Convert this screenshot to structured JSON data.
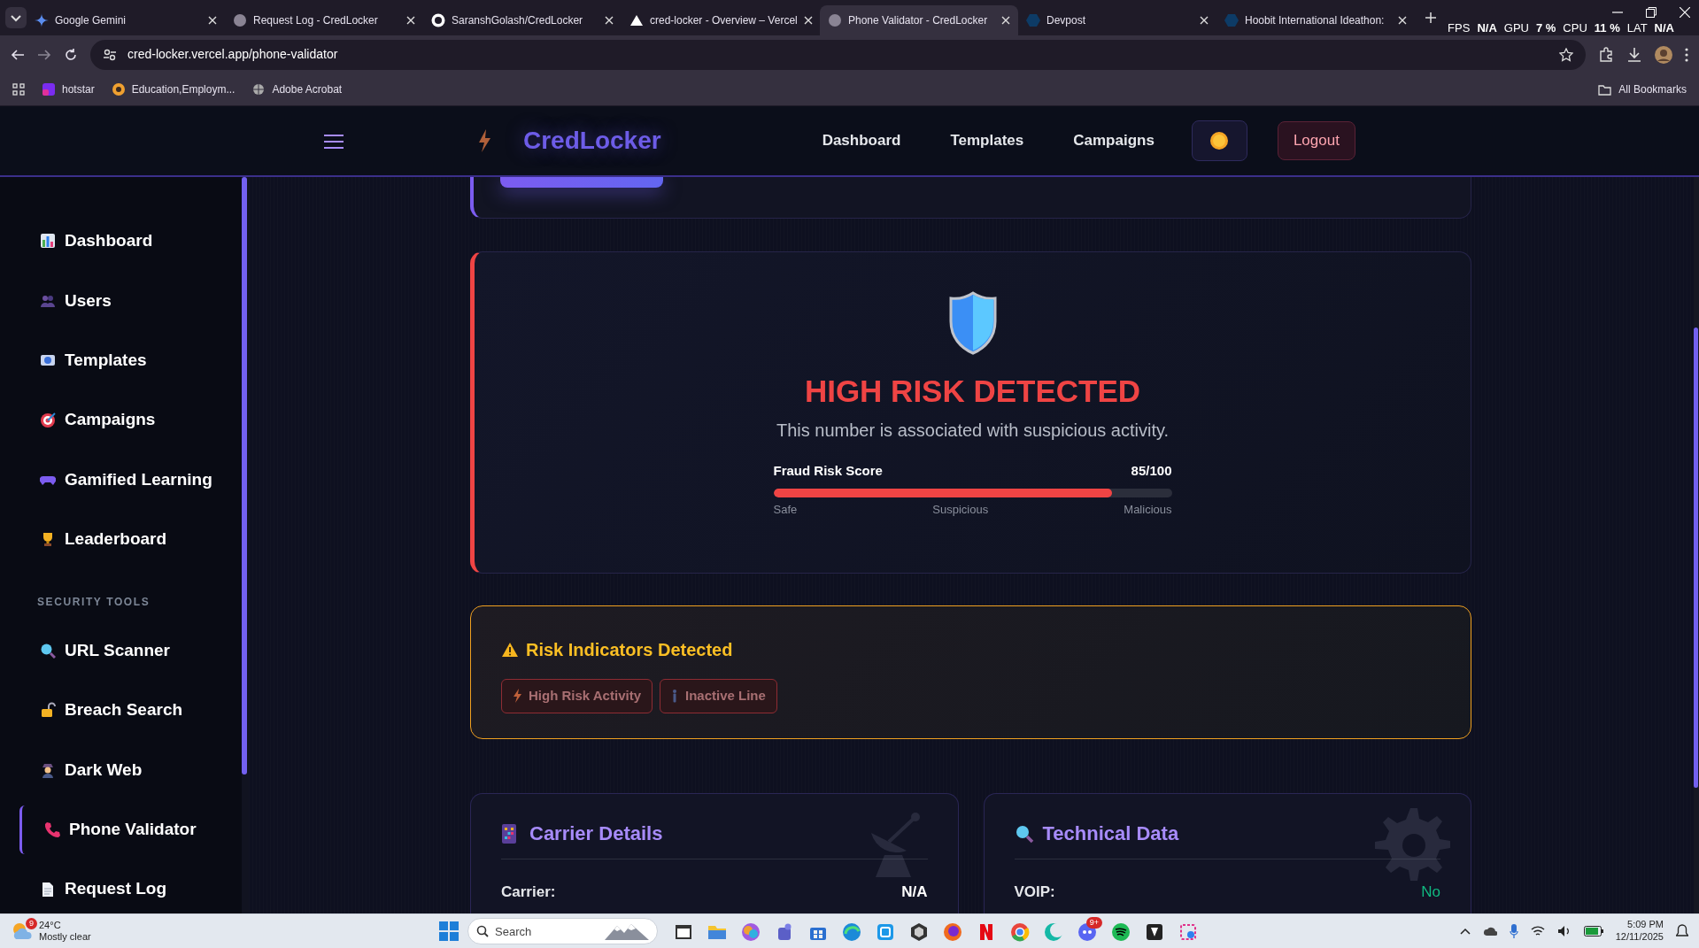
{
  "browser": {
    "tabs": [
      {
        "title": "Google Gemini",
        "selected": false
      },
      {
        "title": "Request Log - CredLocker",
        "selected": false
      },
      {
        "title": "SaranshGolash/CredLocker",
        "selected": false
      },
      {
        "title": "cred-locker - Overview – Vercel",
        "selected": false
      },
      {
        "title": "Phone Validator - CredLocker",
        "selected": true
      },
      {
        "title": "Devpost",
        "selected": false
      },
      {
        "title": "Hoobit International Ideathon:",
        "selected": false
      }
    ],
    "address": "cred-locker.vercel.app/phone-validator",
    "bookmarks": [
      "hotstar",
      "Education,Employm...",
      "Adobe Acrobat"
    ],
    "all_bookmarks": "All Bookmarks"
  },
  "perf_overlay": [
    {
      "label": "FPS",
      "value": "N/A"
    },
    {
      "label": "GPU",
      "value": "7 %"
    },
    {
      "label": "CPU",
      "value": "11 %"
    },
    {
      "label": "LAT",
      "value": "N/A"
    }
  ],
  "header": {
    "brand": "CredLocker",
    "nav": [
      "Dashboard",
      "Templates",
      "Campaigns"
    ],
    "logout": "Logout"
  },
  "sidebar": {
    "items": [
      {
        "label": "Dashboard",
        "selected": false
      },
      {
        "label": "Users",
        "selected": false
      },
      {
        "label": "Templates",
        "selected": false
      },
      {
        "label": "Campaigns",
        "selected": false
      },
      {
        "label": "Gamified Learning",
        "selected": false
      },
      {
        "label": "Leaderboard",
        "selected": false
      }
    ],
    "section": "SECURITY TOOLS",
    "tools": [
      {
        "label": "URL Scanner",
        "selected": false
      },
      {
        "label": "Breach Search",
        "selected": false
      },
      {
        "label": "Dark Web",
        "selected": false
      },
      {
        "label": "Phone Validator",
        "selected": true
      },
      {
        "label": "Request Log",
        "selected": false
      }
    ]
  },
  "result": {
    "title": "HIGH RISK DETECTED",
    "message": "This number is associated with suspicious activity.",
    "score_label": "Fraud Risk Score",
    "score": "85/100",
    "level": 0.85,
    "scale": [
      "Safe",
      "Suspicious",
      "Malicious"
    ]
  },
  "indicators": {
    "title": "Risk Indicators Detected",
    "tags": [
      "High Risk Activity",
      "Inactive Line"
    ]
  },
  "cards": [
    {
      "title": "Carrier Details",
      "rows": [
        {
          "label": "Carrier:",
          "value": "N/A",
          "kind": "plain"
        }
      ]
    },
    {
      "title": "Technical Data",
      "rows": [
        {
          "label": "VOIP:",
          "value": "No",
          "kind": "good"
        }
      ]
    }
  ],
  "taskbar": {
    "weather_badge": "9",
    "temperature": "24°C",
    "condition": "Mostly clear",
    "search_placeholder": "Search",
    "chat_badge": "9+",
    "time": "5:09 PM",
    "date": "12/11/2025"
  }
}
